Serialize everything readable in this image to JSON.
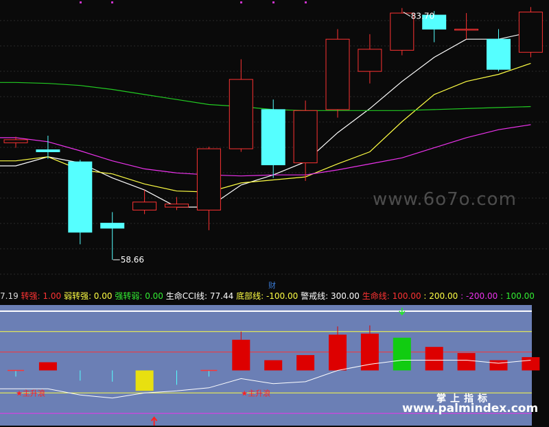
{
  "chart_data": [
    {
      "type": "candlestick",
      "title": "",
      "high_label": "83.70",
      "low_label": "58.66",
      "ylim": [
        56,
        84.5
      ],
      "candles": [
        {
          "o": 70.3,
          "c": 70.6,
          "h": 70.9,
          "l": 69.8
        },
        {
          "o": 69.6,
          "c": 69.4,
          "h": 71.0,
          "l": 68.7
        },
        {
          "o": 68.4,
          "c": 61.4,
          "h": 68.6,
          "l": 60.2
        },
        {
          "o": 62.3,
          "c": 61.8,
          "h": 63.4,
          "l": 58.66
        },
        {
          "o": 63.6,
          "c": 64.4,
          "h": 65.6,
          "l": 63.2
        },
        {
          "o": 63.9,
          "c": 64.2,
          "h": 64.9,
          "l": 63.6
        },
        {
          "o": 63.6,
          "c": 69.7,
          "h": 69.9,
          "l": 61.6
        },
        {
          "o": 69.7,
          "c": 76.6,
          "h": 78.6,
          "l": 69.4
        },
        {
          "o": 73.6,
          "c": 68.1,
          "h": 74.6,
          "l": 66.8
        },
        {
          "o": 68.3,
          "c": 73.5,
          "h": 74.5,
          "l": 66.5
        },
        {
          "o": 73.6,
          "c": 80.6,
          "h": 81.6,
          "l": 72.8
        },
        {
          "o": 77.4,
          "c": 79.6,
          "h": 81.1,
          "l": 76.2
        },
        {
          "o": 79.5,
          "c": 83.2,
          "h": 83.7,
          "l": 79.0
        },
        {
          "o": 83.0,
          "c": 81.6,
          "h": 83.4,
          "l": 80.3
        },
        {
          "o": 81.6,
          "c": 81.6,
          "h": 83.2,
          "l": 80.6
        },
        {
          "o": 80.6,
          "c": 77.6,
          "h": 81.6,
          "l": 77.4
        },
        {
          "o": 79.3,
          "c": 83.3,
          "h": 83.8,
          "l": 78.8
        }
      ],
      "series": [
        {
          "color": "#ffffff",
          "values": [
            68.0,
            68.9,
            68.3,
            66.8,
            65.6,
            63.9,
            63.9,
            66.1,
            67.1,
            68.4,
            71.3,
            73.7,
            76.4,
            78.8,
            80.6,
            80.6,
            81.3
          ]
        },
        {
          "color": "#ffff44",
          "values": [
            68.5,
            68.9,
            67.6,
            67.2,
            66.2,
            65.5,
            65.4,
            66.3,
            66.6,
            66.9,
            68.2,
            69.4,
            72.4,
            75.1,
            76.4,
            77.1,
            78.2
          ]
        },
        {
          "color": "#ee33ee",
          "values": [
            70.8,
            70.4,
            69.5,
            68.5,
            67.7,
            67.3,
            67.1,
            67.0,
            67.1,
            67.1,
            67.6,
            68.2,
            68.8,
            69.8,
            70.8,
            71.6,
            72.1
          ]
        },
        {
          "color": "#22cc22",
          "values": [
            76.3,
            76.2,
            76.0,
            75.6,
            75.1,
            74.6,
            74.1,
            73.9,
            73.6,
            73.5,
            73.5,
            73.5,
            73.5,
            73.6,
            73.7,
            73.8,
            73.9
          ]
        }
      ]
    },
    {
      "type": "bar",
      "title": "",
      "legend": [
        {
          "text": "7.19",
          "color": "#dddddd"
        },
        {
          "text": " 转强: 1.00",
          "color": "#ff3333"
        },
        {
          "text": " 弱转强: 0.00",
          "color": "#ffff44"
        },
        {
          "text": " 强转弱: 0.00",
          "color": "#33ee33"
        },
        {
          "text": " 生命CCI线: 77.44",
          "color": "#ffffff"
        },
        {
          "text": " 底部线: -100.00",
          "color": "#ffff44"
        },
        {
          "text": " 警戒线: 300.00",
          "color": "#ffffff"
        },
        {
          "text": " 生命线: 100.00",
          "color": "#ff3333"
        },
        {
          "text": " : 200.00",
          "color": "#ffff44"
        },
        {
          "text": " : -200.00",
          "color": "#ee33ee"
        },
        {
          "text": " : 100.00",
          "color": "#33ee33"
        }
      ],
      "ylim": [
        -260,
        330
      ],
      "ref_lines": [
        {
          "value": 300,
          "color": "#ffffff"
        },
        {
          "value": 200,
          "color": "#ffff44"
        },
        {
          "value": 100,
          "color": "#ff3333"
        },
        {
          "value": -100,
          "color": "#ffff44"
        },
        {
          "value": -200,
          "color": "#ee33ee"
        }
      ],
      "bars": [
        {
          "kind": "cyan-line",
          "top": 10,
          "bottom": -20
        },
        {
          "kind": "red",
          "top": 50,
          "bottom": 10
        },
        {
          "kind": "cyan-line",
          "top": 10,
          "bottom": -40
        },
        {
          "kind": "cyan-line",
          "top": 10,
          "bottom": -45
        },
        {
          "kind": "yellow",
          "top": 10,
          "bottom": -90
        },
        {
          "kind": "cyan-line",
          "top": 10,
          "bottom": -60
        },
        {
          "kind": "cyan-line",
          "top": 10,
          "bottom": -20
        },
        {
          "kind": "red",
          "top": 160,
          "bottom": 10
        },
        {
          "kind": "red",
          "top": 60,
          "bottom": 10
        },
        {
          "kind": "red",
          "top": 85,
          "bottom": 10
        },
        {
          "kind": "red",
          "top": 185,
          "bottom": 10
        },
        {
          "kind": "red",
          "top": 190,
          "bottom": 10
        },
        {
          "kind": "green",
          "top": 170,
          "bottom": 10
        },
        {
          "kind": "red",
          "top": 125,
          "bottom": 10
        },
        {
          "kind": "red",
          "top": 95,
          "bottom": 10
        },
        {
          "kind": "red",
          "top": 60,
          "bottom": 10
        },
        {
          "kind": "red",
          "top": 75,
          "bottom": 10
        }
      ],
      "cci": [
        -80,
        -80,
        -110,
        -125,
        -100,
        -90,
        -75,
        -30,
        -55,
        -45,
        10,
        40,
        60,
        60,
        60,
        45,
        60
      ],
      "labels": [
        {
          "index": 0,
          "text": "★主升浪"
        },
        {
          "index": 7,
          "text": "★主升浪"
        }
      ]
    }
  ],
  "misc": {
    "cai_label": "财",
    "watermark_top": "www.6o7o.com",
    "watermark_cn": "掌上指标",
    "watermark_url": "www.palmindex.com"
  }
}
